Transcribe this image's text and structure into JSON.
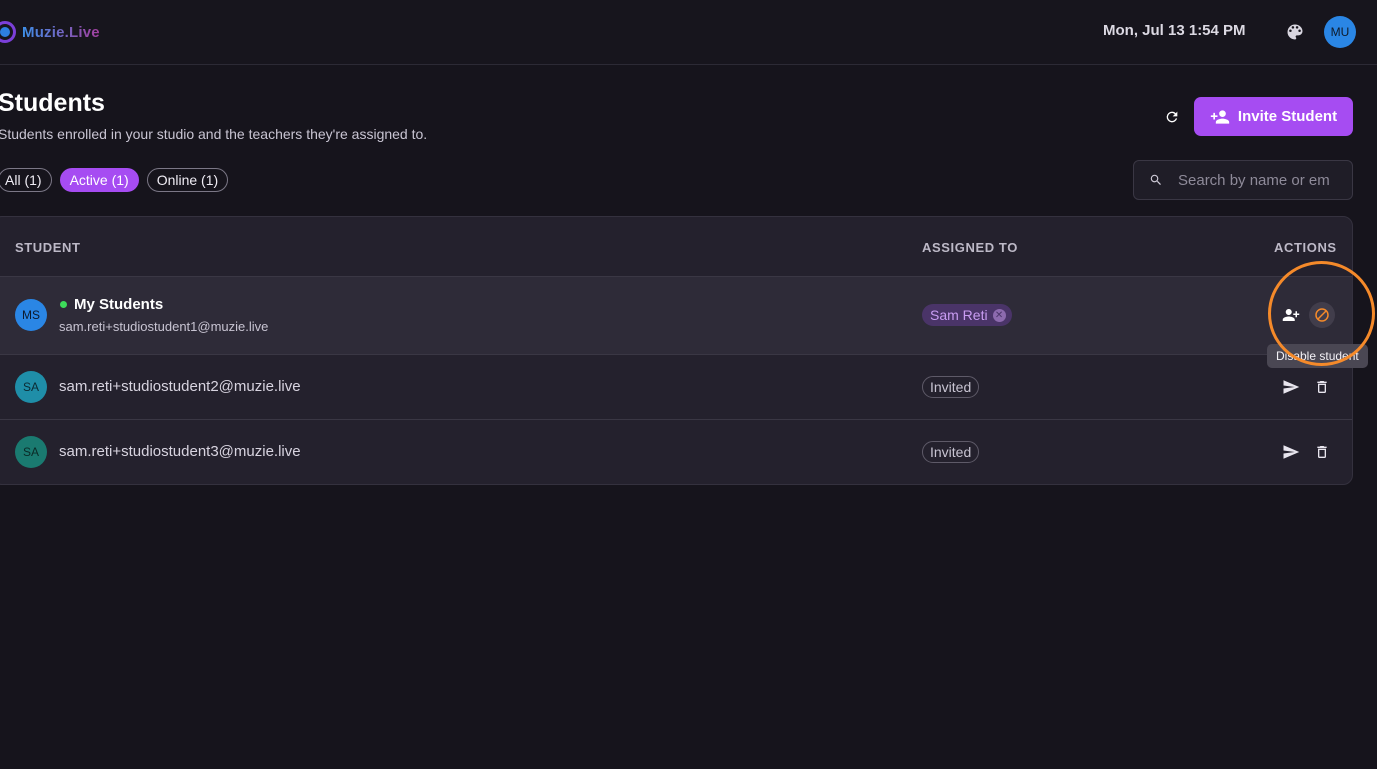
{
  "header": {
    "logo_text": "Muzie.Live",
    "datetime": "Mon, Jul 13 1:54 PM",
    "user_initials": "MU"
  },
  "page": {
    "title": "Students",
    "subtitle": "Students enrolled in your studio and the teachers they're assigned to.",
    "invite_label": "Invite Student"
  },
  "filters": [
    {
      "label": "All (1)",
      "active": false
    },
    {
      "label": "Active (1)",
      "active": true
    },
    {
      "label": "Online (1)",
      "active": false
    }
  ],
  "search": {
    "placeholder": "Search by name or em"
  },
  "table": {
    "columns": [
      "STUDENT",
      "ASSIGNED TO",
      "ACTIONS"
    ],
    "rows": [
      {
        "initials": "MS",
        "name": "My Students",
        "email": "sam.reti+studiostudent1@muzie.live",
        "online": true,
        "assigned": "Sam Reti",
        "actions": [
          "assign-teacher-icon",
          "disable-icon"
        ]
      },
      {
        "initials": "SA",
        "email": "sam.reti+studiostudent2@muzie.live",
        "status": "Invited",
        "actions": [
          "send-icon",
          "trash-icon"
        ]
      },
      {
        "initials": "SA",
        "email": "sam.reti+studiostudent3@muzie.live",
        "status": "Invited",
        "actions": [
          "send-icon",
          "trash-icon"
        ]
      }
    ]
  },
  "tooltip": "Disable student",
  "colors": {
    "accent": "#a64cf2",
    "highlight": "#f58a2a",
    "online": "#3ddc5a",
    "avatar_ms": "#2a86e5",
    "avatar_sa2": "#1f8ea8",
    "avatar_sa3": "#1a7a70"
  }
}
